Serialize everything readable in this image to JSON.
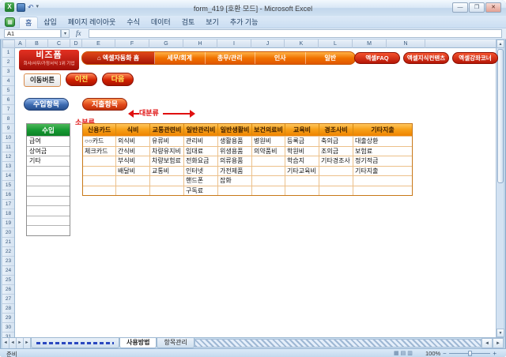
{
  "window": {
    "title": "form_419 [호환 모드] - Microsoft Excel",
    "minimize_glyph": "—",
    "maximize_glyph": "❐",
    "close_glyph": "✕"
  },
  "ribbon": {
    "tabs": [
      {
        "label": "홈",
        "active": true
      },
      {
        "label": "삽입",
        "active": false
      },
      {
        "label": "페이지 레이아웃",
        "active": false
      },
      {
        "label": "수식",
        "active": false
      },
      {
        "label": "데이터",
        "active": false
      },
      {
        "label": "검토",
        "active": false
      },
      {
        "label": "보기",
        "active": false
      },
      {
        "label": "추가 기능",
        "active": false
      }
    ]
  },
  "formula_bar": {
    "name_box": "A1",
    "fx_label": "fx",
    "value": ""
  },
  "grid": {
    "col_letters": [
      "A",
      "B",
      "C",
      "D",
      "E",
      "F",
      "G",
      "H",
      "I",
      "J",
      "K",
      "L",
      "M",
      "N"
    ],
    "row_count": 31
  },
  "content": {
    "logo": {
      "title": "비즈폼",
      "subtitle": "회사/사무/가정서식 1위 기업"
    },
    "nav": {
      "home_icon": "⌂",
      "home_label": "엑셀자동화 홈",
      "items": [
        "세무/회계",
        "총무/관리",
        "인사",
        "일반"
      ],
      "right_buttons": [
        "엑셀FAQ",
        "엑셀지식컨텐츠",
        "엑셀강좌코너"
      ]
    },
    "move_label": "이동버튼",
    "prev_button": "이전",
    "next_button": "다음",
    "income_button": "수입항목",
    "expense_button": "지출항목",
    "major_label": "대분류",
    "minor_label": "소분류",
    "income_table": {
      "header": "수입",
      "items": [
        "급여",
        "상여금",
        "기타"
      ],
      "total_rows": 10
    },
    "expense_table": {
      "headers": [
        "신용카드",
        "식비",
        "교통관련비",
        "일반관리비",
        "일반생활비",
        "보건의료비",
        "교육비",
        "경조사비",
        "기타지출"
      ],
      "rows": [
        [
          "○○카드",
          "외식비",
          "유류비",
          "관리비",
          "생활용품",
          "병원비",
          "등록금",
          "축의금",
          "대출상환"
        ],
        [
          "체크카드",
          "간식비",
          "차량유지비",
          "임대료",
          "위생용품",
          "의약품비",
          "학원비",
          "조의금",
          "보험료"
        ],
        [
          "",
          "부식비",
          "차량보험료",
          "전화요금",
          "의류용품",
          "",
          "학습지",
          "기타경조사",
          "정기적금"
        ],
        [
          "",
          "배달비",
          "교통비",
          "인터넷",
          "가전제품",
          "",
          "기타교육비",
          "",
          "기타지출"
        ],
        [
          "",
          "",
          "",
          "핸드폰",
          "잡화",
          "",
          "",
          "",
          ""
        ],
        [
          "",
          "",
          "",
          "구독료",
          "",
          "",
          "",
          "",
          ""
        ]
      ]
    },
    "colors": {
      "brand_red": "#c81008",
      "nav_orange": "#f07200",
      "expense_header_orange": "#f7a11a",
      "income_green": "#179a33",
      "arrow_red": "#e01010",
      "income_button_blue": "#3c6ab0"
    }
  },
  "sheet_tabs": {
    "tabs": [
      "사용방법",
      "항목관리"
    ],
    "active": "사용방법"
  },
  "status_bar": {
    "ready": "준비",
    "zoom": "100%"
  }
}
